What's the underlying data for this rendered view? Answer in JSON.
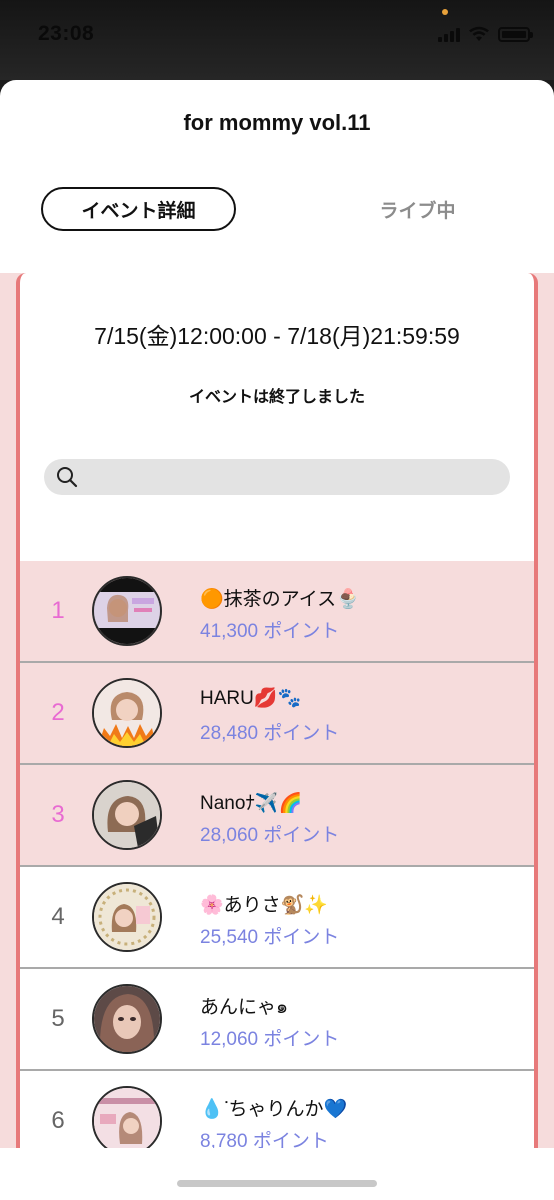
{
  "status_bar": {
    "time": "23:08",
    "accent_dot_color": "#e8a13a",
    "icons": [
      "signal-icon",
      "wifi-icon",
      "battery-icon"
    ]
  },
  "header": {
    "title": "for mommy vol.11"
  },
  "tabs": [
    {
      "label": "イベント詳細",
      "active": true
    },
    {
      "label": "ライブ中",
      "active": false
    }
  ],
  "event": {
    "period": "7/15(金)12:00:00 - 7/18(月)21:59:59",
    "status": "イベントは終了しました"
  },
  "search": {
    "placeholder": "",
    "icon": "search-icon"
  },
  "colors": {
    "accent_pink_border": "#e7797a",
    "top_rank_bg": "#f6dcdc",
    "top_rank_number": "#e86bd2",
    "points_text": "#7b83e0"
  },
  "ranking": [
    {
      "rank": "1",
      "name": "🟠抹茶のアイス🍨",
      "points": "41,300 ポイント",
      "top": true
    },
    {
      "rank": "2",
      "name": "HARU💋🐾",
      "points": "28,480 ポイント",
      "top": true
    },
    {
      "rank": "3",
      "name": "Nanoﾅ✈️🌈",
      "points": "28,060 ポイント",
      "top": true
    },
    {
      "rank": "4",
      "name": "🌸ありさ🐒✨",
      "points": "25,540 ポイント",
      "top": false
    },
    {
      "rank": "5",
      "name": "あんにゃ๑",
      "points": "12,060 ポイント",
      "top": false
    },
    {
      "rank": "6",
      "name": "💧ᐝちゃりんか💙",
      "points": "8,780 ポイント",
      "top": false
    }
  ]
}
